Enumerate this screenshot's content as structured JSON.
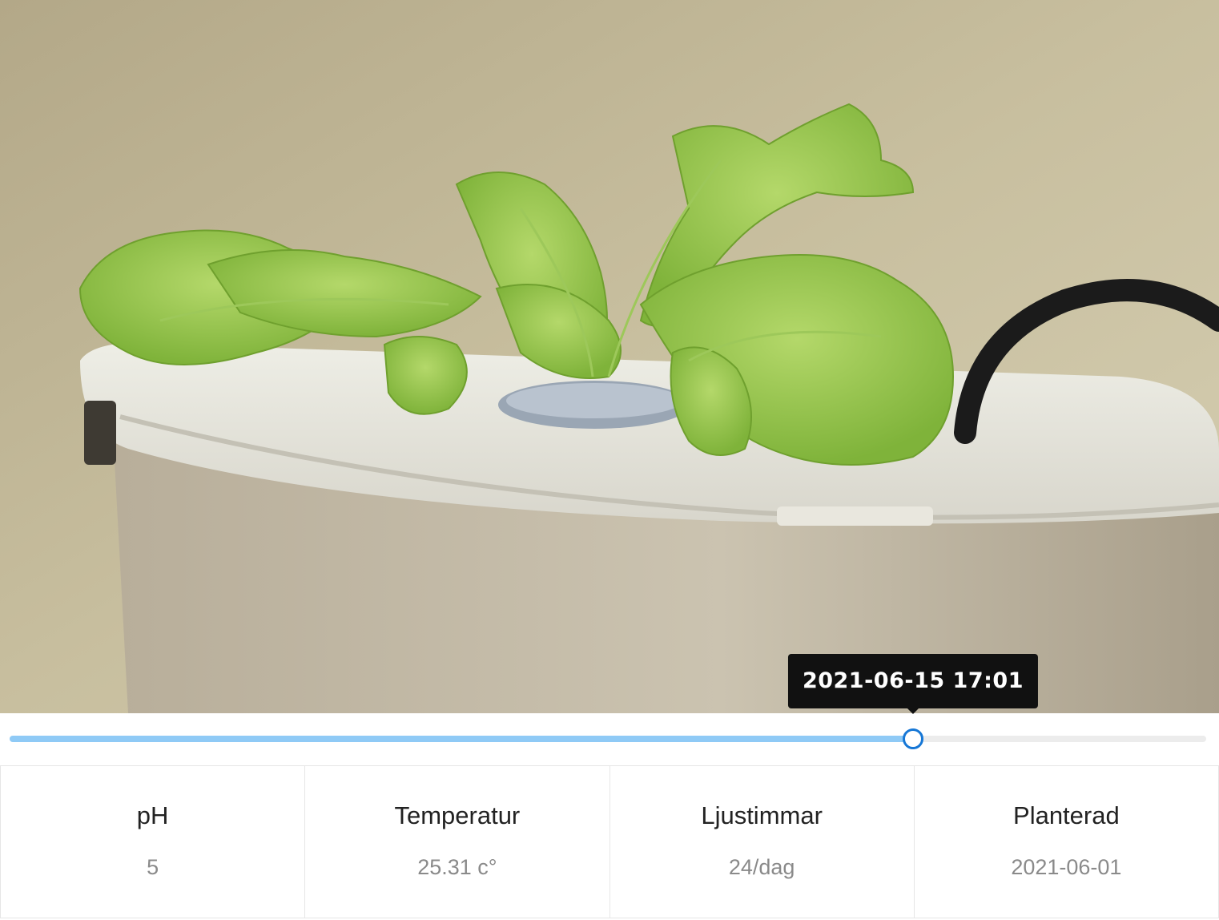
{
  "photo": {
    "description_icon": "lettuce-plant-photo"
  },
  "timeline": {
    "selected_time": "2021-06-15 17:01",
    "position_fraction": 0.755,
    "track_color": "#8fcaf6",
    "handle_color": "#1677d6"
  },
  "stats": [
    {
      "label": "pH",
      "value": "5"
    },
    {
      "label": "Temperatur",
      "value": "25.31 c°"
    },
    {
      "label": "Ljustimmar",
      "value": "24/dag"
    },
    {
      "label": "Planterad",
      "value": "2021-06-01"
    }
  ]
}
